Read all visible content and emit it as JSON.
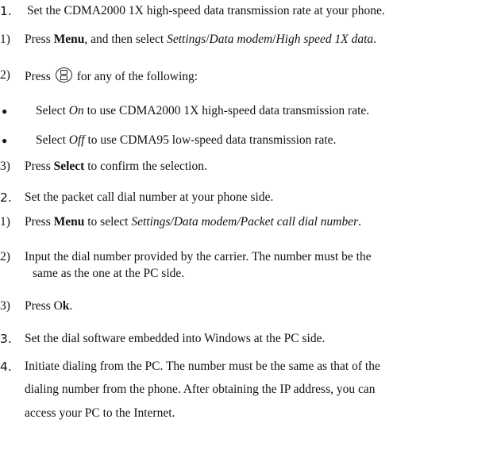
{
  "sections": [
    {
      "num": "1.",
      "text": "Set the CDMA2000 1X high-speed data transmission rate at your phone."
    },
    {
      "num": "2.",
      "text": "Set the packet call dial number at your phone side."
    },
    {
      "num": "3.",
      "text": "Set the dial software embedded into Windows at the PC side."
    },
    {
      "num": "4.",
      "lines": [
        "Initiate dialing from the PC. The number must be the same as that of the",
        "dialing number from the phone. After obtaining the IP address, you can",
        "access your PC to the Internet."
      ]
    }
  ],
  "s1": {
    "step1": {
      "num": "1)",
      "a": "Press ",
      "b": "Menu",
      "c": ", and then select ",
      "d": "Settings",
      "e": "/",
      "f": "Data modem",
      "g": "/",
      "h": "High speed 1X data",
      "i": "."
    },
    "step2": {
      "num": "2)",
      "a": "Press",
      "icon": "navigation-key-icon",
      "b": "for any of the following:"
    },
    "bullet1": {
      "a": "Select ",
      "b": "On",
      "c": " to use CDMA2000 1X high-speed data transmission rate."
    },
    "bullet2": {
      "a": "Select ",
      "b": "Off",
      "c": " to use CDMA95 low-speed data transmission rate."
    },
    "step3": {
      "num": "3)",
      "a": "Press ",
      "b": "Select",
      "c": " to confirm the selection."
    }
  },
  "s2": {
    "step1": {
      "num": "1)",
      "a": "Press ",
      "b": "Menu",
      "c": " to select ",
      "d": "Settings/Data modem/Packet call dial number",
      "e": "."
    },
    "step2": {
      "num": "2)",
      "l1": "Input the dial number provided by the carrier. The number must be the",
      "l2": "same as the one at the PC side."
    },
    "step3": {
      "num": "3)",
      "a": "Press O",
      "b": "k",
      "c": "."
    }
  },
  "bullet_glyph": "●"
}
